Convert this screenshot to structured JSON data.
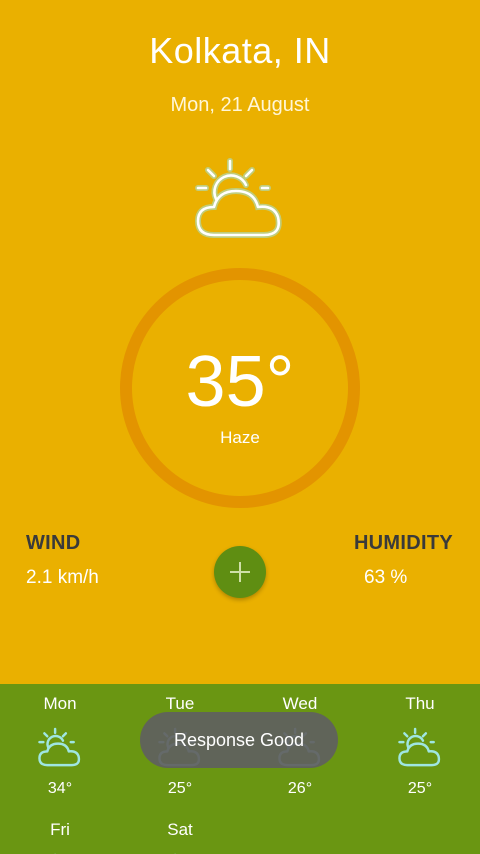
{
  "header": {
    "city": "Kolkata, IN",
    "date": "Mon, 21 August"
  },
  "current": {
    "temperature": "35°",
    "condition": "Haze",
    "icon": "partly-cloudy-icon"
  },
  "details": {
    "wind_label": "WIND",
    "wind_value": "2.1 km/h",
    "humidity_label": "HUMIDITY",
    "humidity_value": "63 %"
  },
  "fab": {
    "icon": "plus-icon"
  },
  "forecast": [
    {
      "day": "Mon",
      "temp": "34°",
      "icon": "partly-cloudy-icon"
    },
    {
      "day": "Tue",
      "temp": "25°",
      "icon": "partly-cloudy-icon"
    },
    {
      "day": "Wed",
      "temp": "26°",
      "icon": "partly-cloudy-icon"
    },
    {
      "day": "Thu",
      "temp": "25°",
      "icon": "partly-cloudy-icon"
    },
    {
      "day": "Fri",
      "icon": "partly-cloudy-icon"
    },
    {
      "day": "Sat",
      "icon": "partly-cloudy-icon"
    }
  ],
  "toast": {
    "message": "Response Good"
  },
  "colors": {
    "background": "#EAB000",
    "ring": "#E39400",
    "forecast_bg": "#6A9612",
    "fab": "#5F8E12",
    "icon_stroke": "#ffffff",
    "icon_glow": "#9FE6E2"
  }
}
